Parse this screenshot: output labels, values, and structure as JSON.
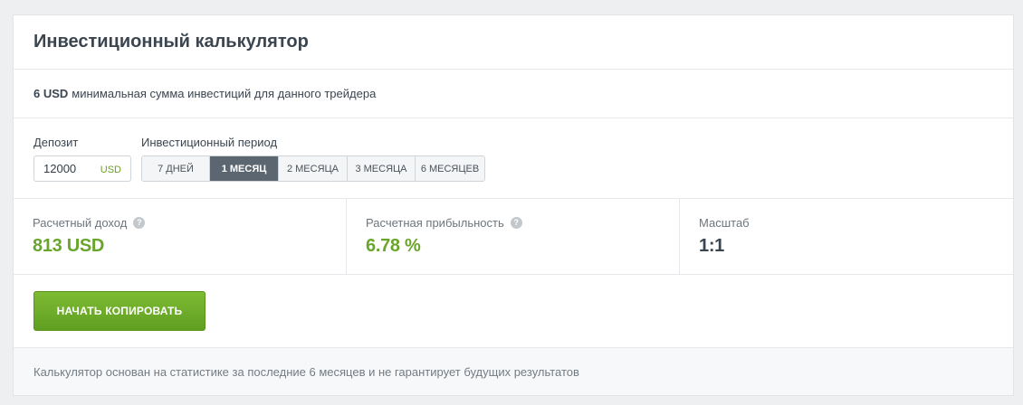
{
  "header": {
    "title": "Инвестиционный калькулятор"
  },
  "min_investment": {
    "amount": "6 USD",
    "text": "минимальная сумма инвестиций для данного трейдера"
  },
  "deposit": {
    "label": "Депозит",
    "value": "12000",
    "currency": "USD"
  },
  "period": {
    "label": "Инвестиционный период",
    "options": [
      "7 ДНЕЙ",
      "1 МЕСЯЦ",
      "2 МЕСЯЦА",
      "3 МЕСЯЦА",
      "6 МЕСЯЦЕВ"
    ],
    "selected": "1 МЕСЯЦ"
  },
  "stats": {
    "income": {
      "label": "Расчетный доход",
      "value": "813 USD"
    },
    "profitability": {
      "label": "Расчетная прибыльность",
      "value": "6.78 %"
    },
    "scale": {
      "label": "Масштаб",
      "value": "1:1"
    }
  },
  "actions": {
    "copy_label": "НАЧАТЬ КОПИРОВАТЬ"
  },
  "footer": {
    "note": "Калькулятор основан на статистике за последние 6 месяцев и не гарантирует будущих результатов"
  },
  "colors": {
    "accent_green": "#6aa52b",
    "active_tab": "#5c6670"
  },
  "icons": {
    "help": "help-circle-icon"
  }
}
